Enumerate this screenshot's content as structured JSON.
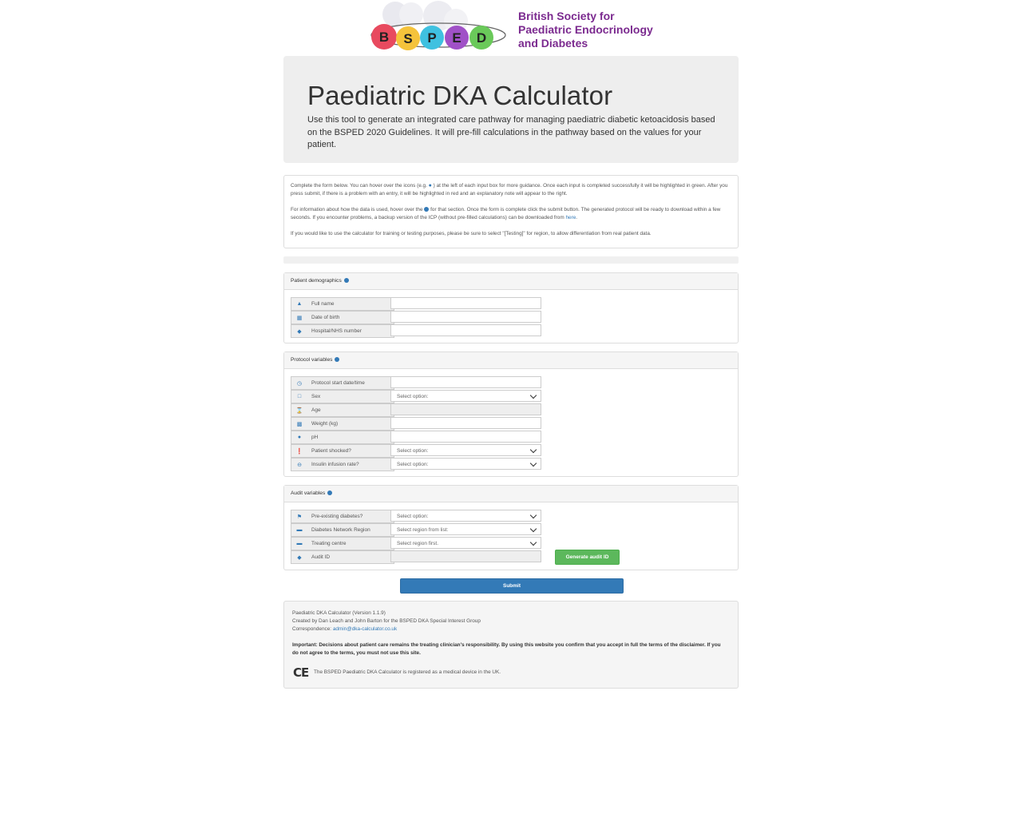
{
  "logo": {
    "letters": [
      "B",
      "S",
      "P",
      "E",
      "D"
    ],
    "org_line1": "British Society for",
    "org_line2": "Paediatric Endocrinology",
    "org_line3": "and Diabetes"
  },
  "jumbotron": {
    "title": "Paediatric DKA Calculator",
    "intro": "Use this tool to generate an integrated care pathway for managing paediatric diabetic ketoacidosis based on the BSPED 2020 Guidelines. It will pre-fill calculations in the pathway based on the values for your patient."
  },
  "info": {
    "p1_a": "Complete the form below. You can hover over the icons (e.g.",
    "p1_b": ") at the left of each input box for more guidance. Once each input is completed successfully it will be highlighted in green. After you press submit, if there is a problem with an entry, it will be highlighted in red and an explanatory note will appear to the right.",
    "p2_a": "For information about how the data is used, hover over the",
    "p2_b": "for that section. Once the form is complete click the submit button. The generated protocol will be ready to download within a few seconds. If you encounter problems, a backup version of the ICP (without pre-filled calculations) can be downloaded from",
    "p2_link": "here",
    "p2_end": ".",
    "p3": "If you would like to use the calculator for training or testing purposes, please be sure to select \"[Testing]\" for region, to allow differentiation from real patient data."
  },
  "demographics": {
    "heading": "Patient demographics",
    "fields": [
      {
        "icon": "user-icon",
        "label": "Full name",
        "value": ""
      },
      {
        "icon": "calendar-icon",
        "label": "Date of birth",
        "value": ""
      },
      {
        "icon": "tag-icon",
        "label": "Hospital/NHS number",
        "value": ""
      }
    ]
  },
  "protocol": {
    "heading": "Protocol variables",
    "fields": [
      {
        "icon": "clock-icon",
        "label": "Protocol start date/time",
        "value": ""
      },
      {
        "icon": "square-icon",
        "label": "Sex",
        "value": "Select option:"
      },
      {
        "icon": "hourglass-icon",
        "label": "Age",
        "value": ""
      },
      {
        "icon": "scale-icon",
        "label": "Weight (kg)",
        "value": ""
      },
      {
        "icon": "droplet-icon",
        "label": "pH",
        "value": ""
      },
      {
        "icon": "exclamation-icon",
        "label": "Patient shocked?",
        "value": "Select option:"
      },
      {
        "icon": "minus-circle-icon",
        "label": "Insulin infusion rate?",
        "value": "Select option:"
      }
    ]
  },
  "audit": {
    "heading": "Audit variables",
    "fields": [
      {
        "icon": "flag-icon",
        "label": "Pre-existing diabetes?",
        "value": "Select option:"
      },
      {
        "icon": "bed-icon",
        "label": "Diabetes Network Region",
        "value": "Select region from list:"
      },
      {
        "icon": "bed-icon",
        "label": "Treating centre",
        "value": "Select region first."
      },
      {
        "icon": "tags-icon",
        "label": "Audit ID",
        "value": ""
      }
    ],
    "generate_label": "Generate audit ID"
  },
  "submit_label": "Submit",
  "footer": {
    "version": "Paediatric DKA Calculator (Version 1.1.9)",
    "created": "Created by Dan Leach and John Barton for the BSPED DKA Special Interest Group",
    "corr_label": "Correspondence:",
    "corr_email": "admin@dka-calculator.co.uk",
    "important": "Important: Decisions about patient care remains the treating clinician's responsibility. By using this website you confirm that you accept in full the terms of the disclaimer. If you do not agree to the terms, you must not use this site.",
    "ce_mark": "CE",
    "ce_text": "The BSPED Paediatric DKA Calculator is registered as a medical device in the UK."
  },
  "colors": {
    "brand_purple": "#7b2a8f",
    "primary": "#337ab7",
    "success": "#5cb85c"
  }
}
